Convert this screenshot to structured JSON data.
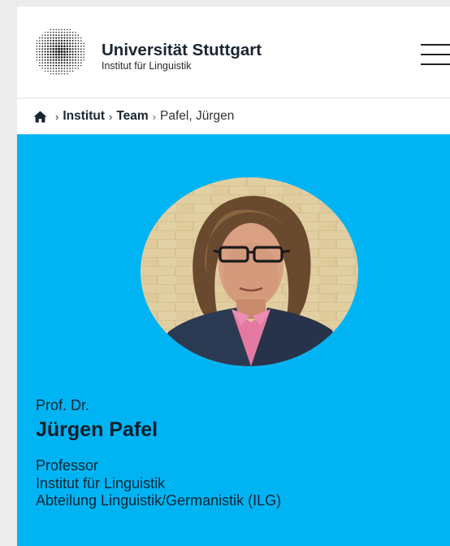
{
  "header": {
    "brand_name": "Universität Stuttgart",
    "brand_sub": "Institut für Linguistik",
    "logo_icon": "university-logo-icon",
    "menu_icon": "hamburger-menu-icon"
  },
  "breadcrumb": {
    "home_icon": "home-icon",
    "items": [
      "Institut",
      "Team"
    ],
    "current": "Pafel, Jürgen",
    "separator": "›"
  },
  "profile": {
    "title": "Prof. Dr.",
    "name": "Jürgen Pafel",
    "roles": [
      "Professor",
      "Institut für Linguistik",
      "Abteilung Linguistik/Germanistik (ILG)"
    ]
  },
  "colors": {
    "hero_background": "#00b4f4",
    "text_dark": "#0e2433",
    "page_background": "#ececec"
  }
}
